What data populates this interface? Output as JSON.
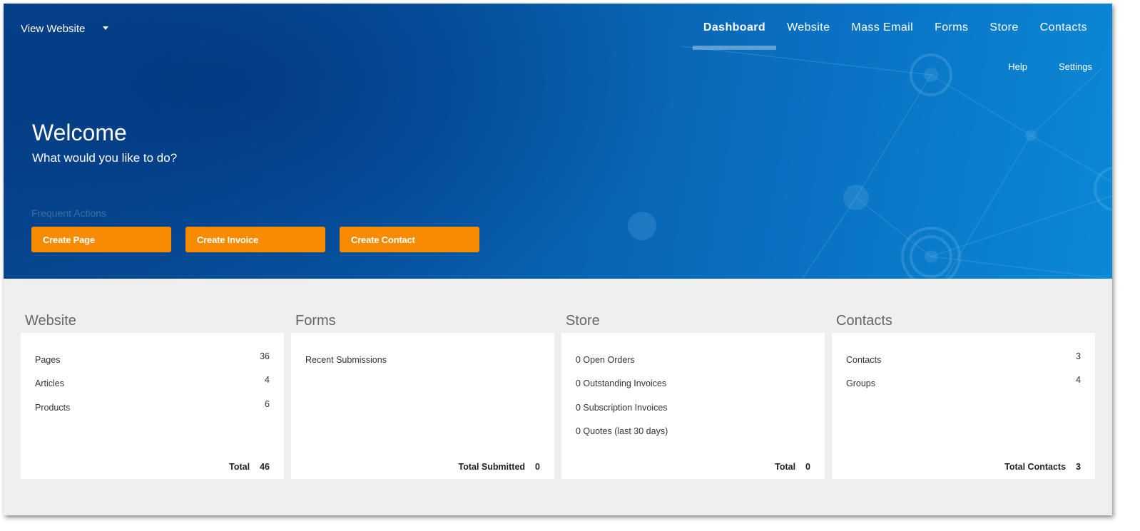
{
  "header": {
    "view_website_label": "View Website",
    "nav": [
      {
        "label": "Dashboard",
        "active": true
      },
      {
        "label": "Website",
        "active": false
      },
      {
        "label": "Mass Email",
        "active": false
      },
      {
        "label": "Forms",
        "active": false
      },
      {
        "label": "Store",
        "active": false
      },
      {
        "label": "Contacts",
        "active": false
      }
    ],
    "subnav": [
      "Help",
      "Settings"
    ]
  },
  "hero": {
    "title": "Welcome",
    "subtitle": "What would you like to do?",
    "frequent_label": "Frequent Actions",
    "actions": [
      "Create Page",
      "Create Invoice",
      "Create Contact"
    ]
  },
  "panels": {
    "website": {
      "title": "Website",
      "rows": [
        {
          "label": "Pages",
          "value": "36"
        },
        {
          "label": "Articles",
          "value": "4"
        },
        {
          "label": "Products",
          "value": "6"
        }
      ],
      "total_label": "Total",
      "total_value": "46"
    },
    "forms": {
      "title": "Forms",
      "rows": [
        {
          "label": "Recent Submissions"
        }
      ],
      "total_label": "Total Submitted",
      "total_value": "0"
    },
    "store": {
      "title": "Store",
      "rows": [
        {
          "label": "0 Open Orders"
        },
        {
          "label": "0 Outstanding Invoices"
        },
        {
          "label": "0 Subscription Invoices"
        },
        {
          "label": "0 Quotes (last 30 days)"
        }
      ],
      "total_label": "Total",
      "total_value": "0"
    },
    "contacts": {
      "title": "Contacts",
      "rows": [
        {
          "label": "Contacts",
          "value": "3"
        },
        {
          "label": "Groups",
          "value": "4"
        }
      ],
      "total_label": "Total Contacts",
      "total_value": "3"
    }
  },
  "colors": {
    "accent_orange": "#f98b00",
    "hero_blue_dark": "#06468f",
    "hero_blue_light": "#0b89d6",
    "page_bg": "#efefef"
  }
}
